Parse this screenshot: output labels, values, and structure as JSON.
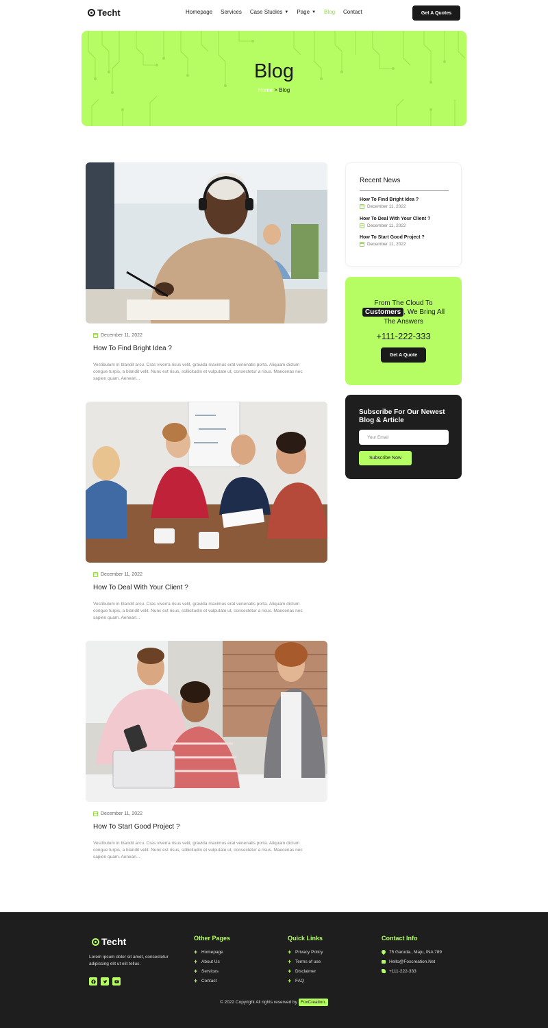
{
  "brand": {
    "name": "Techt"
  },
  "nav": {
    "items": [
      {
        "label": "Homepage"
      },
      {
        "label": "Services"
      },
      {
        "label": "Case Studies"
      },
      {
        "label": "Page"
      },
      {
        "label": "Blog"
      },
      {
        "label": "Contact"
      }
    ],
    "cta_label": "Get A Quotes"
  },
  "hero": {
    "title": "Blog",
    "breadcrumb": {
      "home": "Home",
      "separator": " > ",
      "current": "Blog"
    }
  },
  "posts": [
    {
      "date": "December 11, 2022",
      "title": "How To Find Bright Idea ?",
      "excerpt": "Vestibulum in blandit arcu. Cras viverra risus velit, gravida maximus erat venenatis porta. Aliquam dictum congue turpis, a blandit velit. Nunc est risus, sollicitudin et vulputate ut, consectetur a risus. Maecenas nec sapien quam. Aenean..."
    },
    {
      "date": "December 11, 2022",
      "title": "How To Deal With Your Client ?",
      "excerpt": "Vestibulum in blandit arcu. Cras viverra risus velit, gravida maximus erat venenatis porta. Aliquam dictum congue turpis, a blandit velit. Nunc est risus, sollicitudin et vulputate ut, consectetur a risus. Maecenas nec sapien quam. Aenean..."
    },
    {
      "date": "December 11, 2022",
      "title": "How To Start Good Project ?",
      "excerpt": "Vestibulum in blandit arcu. Cras viverra risus velit, gravida maximus erat venenatis porta. Aliquam dictum congue turpis, a blandit velit. Nunc est risus, sollicitudin et vulputate ut, consectetur a risus. Maecenas nec sapien quam. Aenean..."
    }
  ],
  "sidebar": {
    "recent_news": {
      "title": "Recent News",
      "items": [
        {
          "title": "How To Find Bright Idea ?",
          "date": "December 11, 2022"
        },
        {
          "title": "How To Deal With Your Client ?",
          "date": "December 11, 2022"
        },
        {
          "title": "How To Start Good Project ?",
          "date": "December 11, 2022"
        }
      ]
    },
    "cta": {
      "line1": "From The Cloud To",
      "highlight": "Customers",
      "line2_rest": ", We Bring All",
      "line3": "The Answers",
      "phone": "+111-222-333",
      "button": "Get A Quote"
    },
    "subscribe": {
      "title": "Subscribe For Our Newest Blog & Article",
      "placeholder": "Your Email",
      "button": "Subscribe Now"
    }
  },
  "footer": {
    "about": "Lorem ipsum dolor sit amet, consectetur adipiscing elit ut elit tellus.",
    "other_pages": {
      "title": "Other Pages",
      "links": [
        "Homepage",
        "About Us",
        "Services",
        "Contact"
      ]
    },
    "quick_links": {
      "title": "Quick Links",
      "links": [
        "Privacy Policy",
        "Terms of use",
        "Disclaimer",
        "FAQ"
      ]
    },
    "contact": {
      "title": "Contact Info",
      "address": "75 Garuda., Maju, INA 789",
      "email": "Hello@Foxcreation.Net",
      "phone": "+111-222-333"
    },
    "copyright": "© 2022 Copyright All rights reserved by",
    "copyright_brand": "FoxCreation."
  },
  "colors": {
    "accent": "#b6fd63",
    "dark": "#1e1e1e",
    "active_nav": "#8fdc3a"
  },
  "icons": [
    "calendar-icon",
    "facebook-icon",
    "twitter-icon",
    "youtube-icon",
    "location-pin-icon",
    "mail-icon",
    "phone-icon",
    "plus-icon"
  ]
}
